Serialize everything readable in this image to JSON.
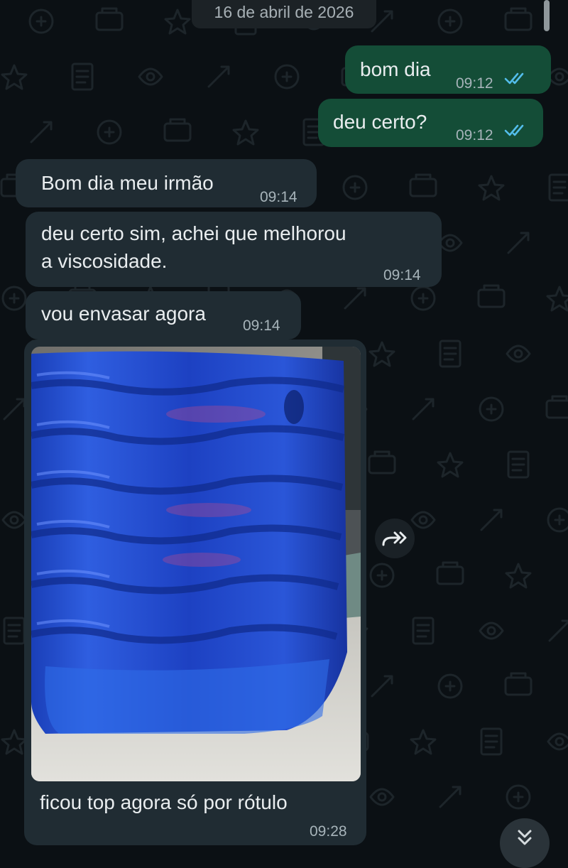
{
  "date_separator": "16 de abril de 2026",
  "messages": [
    {
      "direction": "outgoing",
      "text": "bom dia",
      "time": "09:12",
      "status": "read"
    },
    {
      "direction": "outgoing",
      "text": "deu certo?",
      "time": "09:12",
      "status": "read"
    },
    {
      "direction": "incoming",
      "text": "Bom dia meu irmão",
      "time": "09:14"
    },
    {
      "direction": "incoming",
      "lines": [
        "deu certo sim, achei que melhorou",
        "a viscosidade."
      ],
      "time": "09:14"
    },
    {
      "direction": "incoming",
      "text": "vou envasar agora",
      "time": "09:14"
    },
    {
      "direction": "incoming",
      "type": "image",
      "image_description": "blue liquid in a ribbed plastic bottle",
      "caption": "ficou top agora só por rótulo",
      "time": "09:28"
    }
  ],
  "icons": {
    "read_receipt": "double-check-icon",
    "forward": "forward-icon",
    "scroll_down": "double-chevron-down-icon"
  },
  "colors": {
    "background": "#0b1014",
    "outgoing_bubble": "#144d37",
    "incoming_bubble": "#202c33",
    "read_tick": "#53bdeb",
    "time_text": "#a7b4ba"
  }
}
